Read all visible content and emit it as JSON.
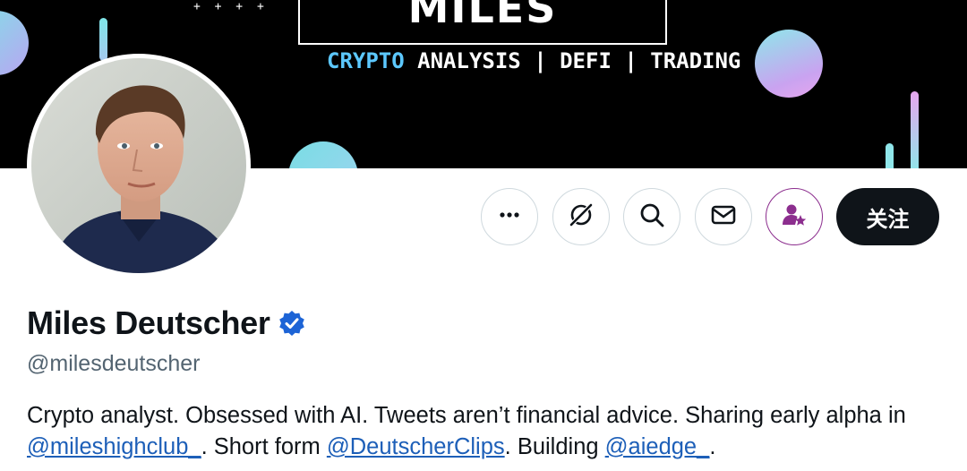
{
  "banner": {
    "brand_title": "MILES DEUTSCHER",
    "tagline_accent": "CRYPTO",
    "tagline_rest": " ANALYSIS | DEFI | TRADING",
    "sparkles": "+ + + +"
  },
  "actions": {
    "more_icon": "more-dots-icon",
    "grok_icon": "grok-icon",
    "search_icon": "search-icon",
    "message_icon": "envelope-icon",
    "subscribe_icon": "person-star-icon",
    "follow_label": "关注"
  },
  "profile": {
    "name": "Miles Deutscher",
    "handle": "@milesdeutscher",
    "bio_part1": "Crypto analyst. Obsessed with AI. Tweets aren’t financial advice. Sharing early alpha in ",
    "bio_link1": "@mileshighclub_",
    "bio_part2": ". Short form ",
    "bio_link2": "@DeutscherClips",
    "bio_part3": ". Building ",
    "bio_link3": "@aiedge_",
    "bio_part4": "."
  },
  "colors": {
    "verified_blue": "#1d64d6",
    "link_blue": "#1d5fb8",
    "subscribe_purple": "#8c2e8e",
    "follow_bg": "#0f1419"
  }
}
